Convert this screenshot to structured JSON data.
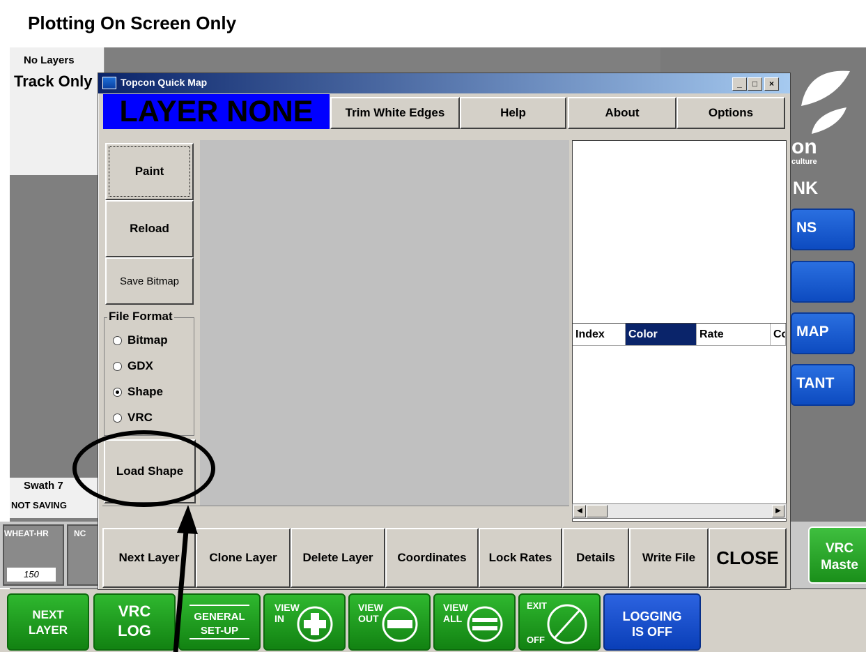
{
  "page_title": "Plotting On Screen Only",
  "left_panel": {
    "no_layers": "No Layers",
    "track_only": "Track Only"
  },
  "status": {
    "swath": "Swath 7",
    "not_saving": "NOT SAVING"
  },
  "side_buttons": [
    "NS",
    "",
    "MAP",
    "TANT"
  ],
  "logo": {
    "line1": "on",
    "line2": "culture",
    "line3": "NK"
  },
  "tiles": [
    {
      "label": "WHEAT-HR",
      "value": "150"
    },
    {
      "label": "NC",
      "value": ""
    }
  ],
  "vrc_master": {
    "line1": "VRC",
    "line2": "Maste"
  },
  "dialog": {
    "title": "Topcon Quick Map",
    "layer_banner": "LAYER NONE",
    "top_buttons": [
      "Trim White Edges",
      "Help",
      "About",
      "Options"
    ],
    "left_buttons": {
      "paint": "Paint",
      "reload": "Reload",
      "save_bitmap": "Save Bitmap",
      "load_shape": "Load Shape"
    },
    "file_format": {
      "legend": "File Format",
      "options": [
        "Bitmap",
        "GDX",
        "Shape",
        "VRC"
      ],
      "selected": "Shape"
    },
    "table_headers": [
      "Index",
      "Color",
      "Rate",
      "Co"
    ],
    "bottom_buttons": [
      "Next Layer",
      "Clone Layer",
      "Delete Layer",
      "Coordinates",
      "Lock Rates",
      "Details",
      "Write File",
      "CLOSE"
    ]
  },
  "bottom_bar": [
    {
      "name": "next-layer",
      "line1": "NEXT",
      "line2": "LAYER"
    },
    {
      "name": "vrc-log",
      "line1": "VRC",
      "line2": "LOG"
    },
    {
      "name": "general-setup",
      "line1": "GENERAL",
      "line2": "SET-UP"
    },
    {
      "name": "view-in",
      "line1": "VIEW",
      "line2": "IN"
    },
    {
      "name": "view-out",
      "line1": "VIEW",
      "line2": "OUT"
    },
    {
      "name": "view-all",
      "line1": "VIEW",
      "line2": "ALL"
    },
    {
      "name": "exit",
      "line1": "EXIT",
      "line2": "OFF"
    }
  ],
  "logging": {
    "line1": "LOGGING",
    "line2": "IS OFF"
  },
  "colors": {
    "banner_blue": "#0000ff",
    "accent_green": "#1a8f1a",
    "logging_blue": "#0a3fb8"
  }
}
